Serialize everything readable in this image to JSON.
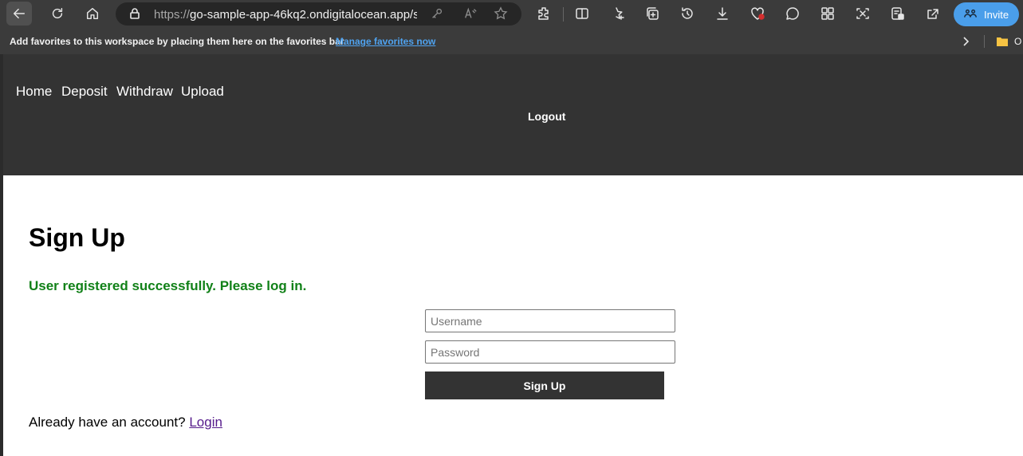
{
  "browser": {
    "url_protocol": "https://",
    "url_host": "go-sample-app-46kq2.ondigitalocean.app/si...",
    "invite_label": "Invite",
    "favorites_message": "Add favorites to this workspace by placing them here on the favorites bar.",
    "manage_favorites_label": "Manage favorites now",
    "folder_label": "O",
    "accent_color": "#4a9eea"
  },
  "nav": {
    "items": [
      {
        "label": "Home"
      },
      {
        "label": "Deposit"
      },
      {
        "label": "Withdraw"
      },
      {
        "label": "Upload"
      }
    ],
    "logout_label": "Logout"
  },
  "page": {
    "title": "Sign Up",
    "success_message": "User registered successfully. Please log in.",
    "success_color": "#118118",
    "username_placeholder": "Username",
    "password_placeholder": "Password",
    "submit_label": "Sign Up",
    "account_prompt": "Already have an account?",
    "login_link": "Login"
  }
}
